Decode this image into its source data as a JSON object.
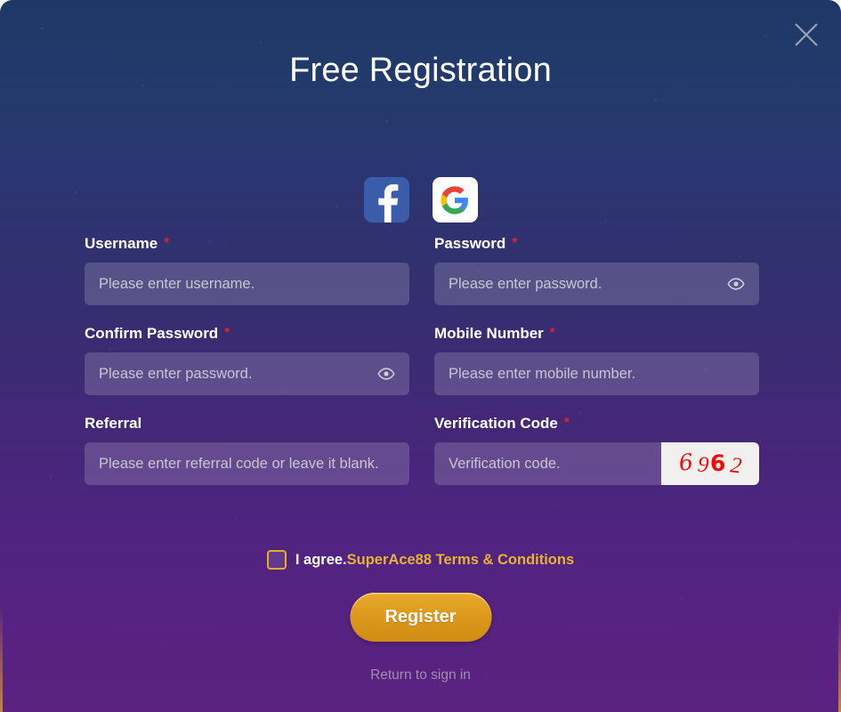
{
  "dialog": {
    "title": "Free Registration",
    "close_icon": "close-icon"
  },
  "social": {
    "facebook_label": "f",
    "facebook_name": "facebook-icon",
    "google_name": "google-icon"
  },
  "form": {
    "fields": [
      {
        "key": "username",
        "label": "Username",
        "required": true,
        "required_mark": "*",
        "placeholder": "Please enter username.",
        "value": ""
      },
      {
        "key": "password",
        "label": "Password",
        "required": true,
        "required_mark": "*",
        "placeholder": "Please enter password.",
        "value": "",
        "toggle_icon": "eye-icon"
      },
      {
        "key": "confirm_password",
        "label": "Confirm Password",
        "required": true,
        "required_mark": "*",
        "placeholder": "Please enter password.",
        "value": "",
        "toggle_icon": "eye-icon"
      },
      {
        "key": "mobile_number",
        "label": "Mobile Number",
        "required": true,
        "required_mark": "*",
        "placeholder": "Please enter mobile number.",
        "value": ""
      },
      {
        "key": "referral",
        "label": "Referral",
        "required": false,
        "required_mark": "",
        "placeholder": "Please enter referral code or leave it blank.",
        "value": ""
      },
      {
        "key": "verification_code",
        "label": "Verification Code",
        "required": true,
        "required_mark": "*",
        "placeholder": "Verification code.",
        "value": ""
      }
    ],
    "captcha": {
      "code": "6962",
      "digits": [
        "6",
        "9",
        "6",
        "2"
      ],
      "text_color": "#f00b0b",
      "background_color": "#f2f0ee"
    }
  },
  "agreement": {
    "checked": false,
    "prefix": "I agree.",
    "link_text": "SuperAce88 Terms & Conditions",
    "link_color": "#e9b234"
  },
  "actions": {
    "register_label": "Register",
    "register_color": "#dd9a1d",
    "return_label": "Return to sign in"
  }
}
